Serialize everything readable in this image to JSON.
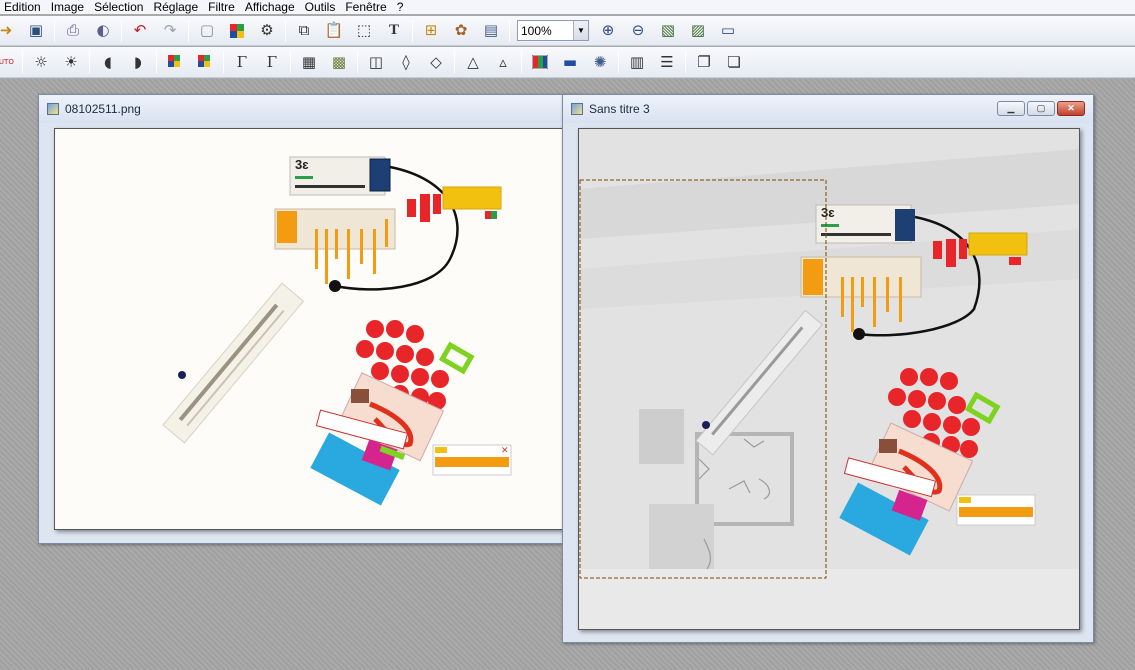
{
  "menu": {
    "items": [
      "Edition",
      "Image",
      "Sélection",
      "Réglage",
      "Filtre",
      "Affichage",
      "Outils",
      "Fenêtre",
      "?"
    ]
  },
  "toolbar1": {
    "zoom_value": "100%"
  },
  "icons": {
    "tb1": [
      "open-icon",
      "save-icon",
      "print-icon",
      "scanner-icon",
      "undo-icon",
      "redo-icon",
      "blank-layer-icon",
      "palette-icon",
      "script-icon",
      "copy-icon",
      "paste-icon",
      "select-icon",
      "text-icon",
      "tree-icon",
      "settings-icon",
      "window-icon"
    ],
    "tb2": [
      "auto-icon",
      "brightness-minus-icon",
      "brightness-plus-icon",
      "contrast-minus-icon",
      "contrast-plus-icon",
      "color-minus-icon",
      "color-plus-icon",
      "gamma-minus-icon",
      "gamma-plus-icon",
      "grid-icon",
      "mosaic-icon",
      "flip-icon",
      "drop-icon",
      "drop-outline-icon",
      "triangle-icon",
      "triangle-outline-icon",
      "rgb-icon",
      "monitor-icon",
      "effect-icon",
      "split-icon",
      "align-icon",
      "layers-icon",
      "layers-out-icon"
    ]
  },
  "windows": {
    "left": {
      "title": "08102511.png"
    },
    "right": {
      "title": "Sans titre 3"
    }
  },
  "colors": {
    "accent": "#1d4fa0",
    "red": "#e8262a",
    "orange": "#f39c12",
    "green": "#7ed321",
    "cyan": "#2aa8e0",
    "magenta": "#d6248f"
  }
}
